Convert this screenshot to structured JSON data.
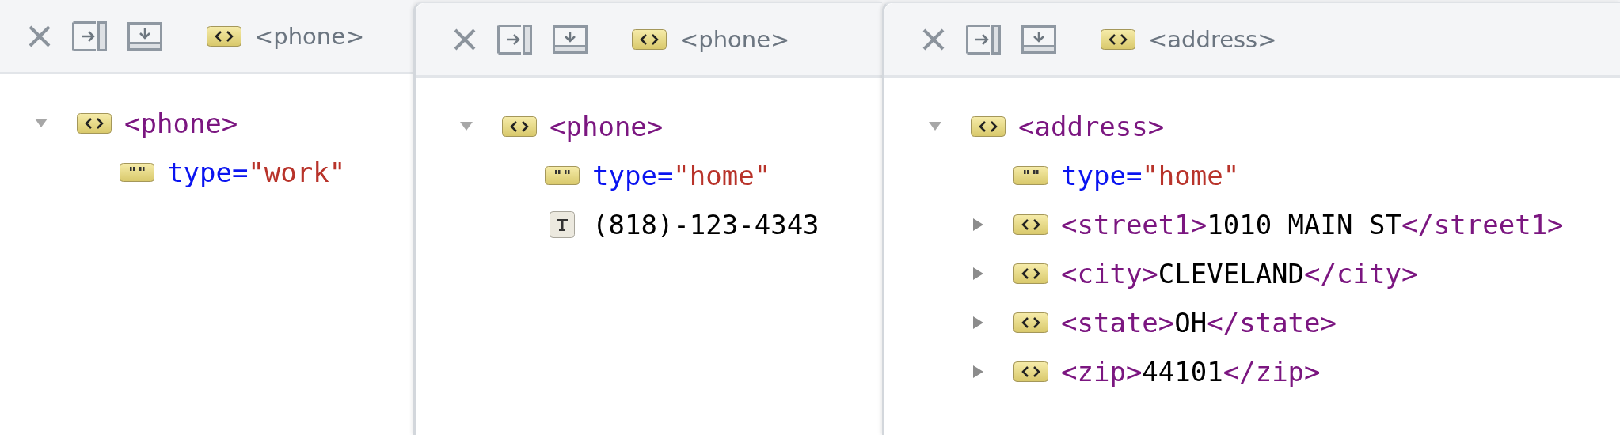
{
  "panels": [
    {
      "title": "<phone>",
      "nodes": [
        {
          "kind": "element",
          "open": "<phone>",
          "expanded": true,
          "children": [
            {
              "kind": "attribute",
              "name": "type=",
              "value": "\"work\""
            }
          ]
        }
      ]
    },
    {
      "title": "<phone>",
      "nodes": [
        {
          "kind": "element",
          "open": "<phone>",
          "expanded": true,
          "children": [
            {
              "kind": "attribute",
              "name": "type=",
              "value": "\"home\""
            },
            {
              "kind": "text",
              "text": "(818)-123-4343"
            }
          ]
        }
      ]
    },
    {
      "title": "<address>",
      "nodes": [
        {
          "kind": "element",
          "open": "<address>",
          "expanded": true,
          "children": [
            {
              "kind": "attribute",
              "name": "type=",
              "value": "\"home\""
            },
            {
              "kind": "element",
              "open": "<street1>",
              "text": "1010 MAIN ST",
              "close": "</street1>",
              "expanded": false
            },
            {
              "kind": "element",
              "open": "<city>",
              "text": "CLEVELAND",
              "close": "</city>",
              "expanded": false
            },
            {
              "kind": "element",
              "open": "<state>",
              "text": "OH",
              "close": "</state>",
              "expanded": false
            },
            {
              "kind": "element",
              "open": "<zip>",
              "text": "44101",
              "close": "</zip>",
              "expanded": false
            }
          ]
        }
      ]
    }
  ]
}
